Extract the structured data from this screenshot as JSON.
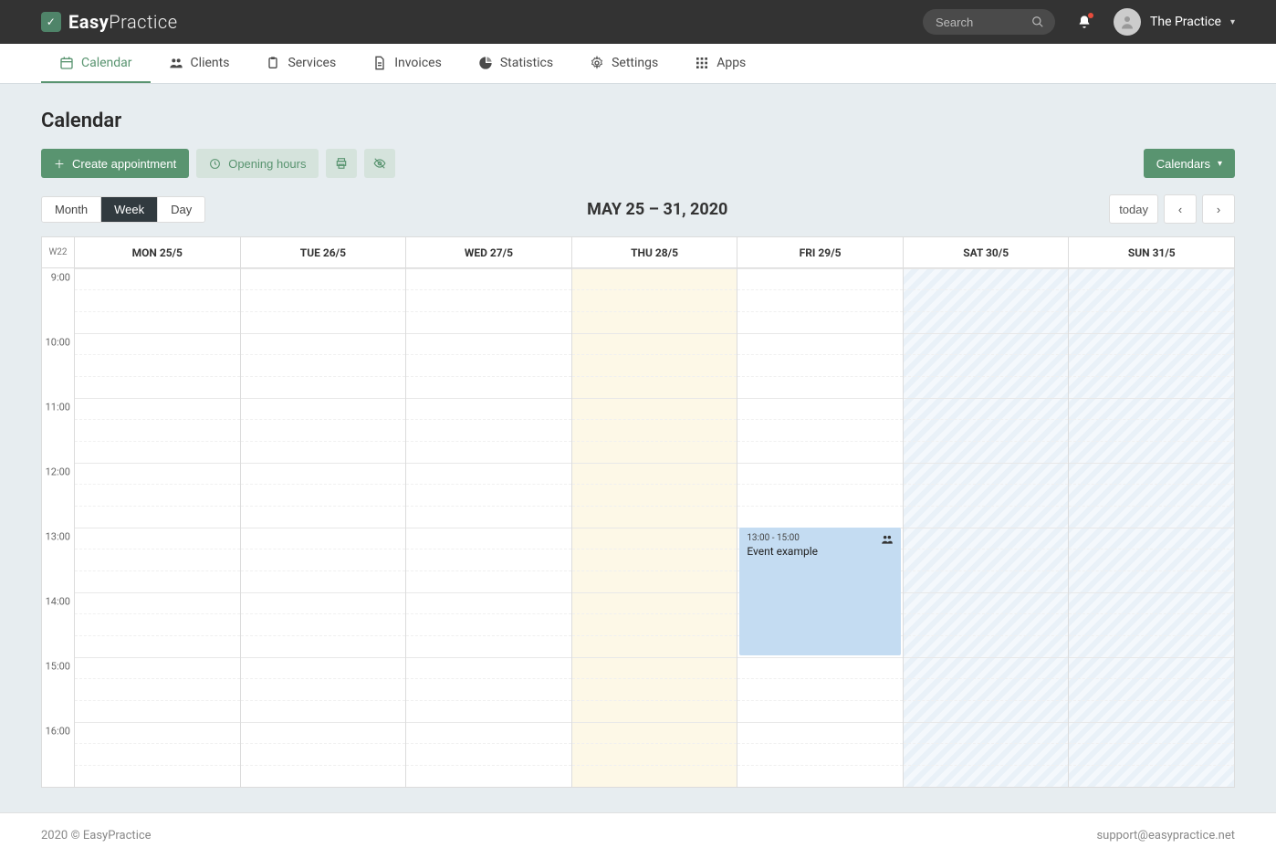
{
  "brand": {
    "bold": "Easy",
    "light": "Practice"
  },
  "search": {
    "placeholder": "Search"
  },
  "user": {
    "name": "The Practice"
  },
  "nav": [
    {
      "label": "Calendar",
      "icon": "calendar-icon",
      "active": true
    },
    {
      "label": "Clients",
      "icon": "people-icon"
    },
    {
      "label": "Services",
      "icon": "clipboard-icon"
    },
    {
      "label": "Invoices",
      "icon": "document-icon"
    },
    {
      "label": "Statistics",
      "icon": "chart-icon"
    },
    {
      "label": "Settings",
      "icon": "gear-icon"
    },
    {
      "label": "Apps",
      "icon": "grid-icon"
    }
  ],
  "page": {
    "title": "Calendar"
  },
  "actions": {
    "create": "Create appointment",
    "openingHours": "Opening hours",
    "calendars": "Calendars"
  },
  "views": {
    "month": "Month",
    "week": "Week",
    "day": "Day",
    "active": "Week"
  },
  "range": {
    "title": "MAY 25 – 31, 2020",
    "todayBtn": "today"
  },
  "calendar": {
    "weekLabel": "W22",
    "days": [
      {
        "label": "MON 25/5",
        "type": "normal"
      },
      {
        "label": "TUE 26/5",
        "type": "normal"
      },
      {
        "label": "WED 27/5",
        "type": "normal"
      },
      {
        "label": "THU 28/5",
        "type": "today"
      },
      {
        "label": "FRI 29/5",
        "type": "normal"
      },
      {
        "label": "SAT 30/5",
        "type": "weekend"
      },
      {
        "label": "SUN 31/5",
        "type": "weekend"
      }
    ],
    "startHour": 9,
    "endHour": 17,
    "events": [
      {
        "day": 4,
        "startHour": 13,
        "endHour": 15,
        "time": "13:00 - 15:00",
        "title": "Event example"
      }
    ]
  },
  "footer": {
    "copyright": "2020 © EasyPractice",
    "email": "support@easypractice.net"
  }
}
